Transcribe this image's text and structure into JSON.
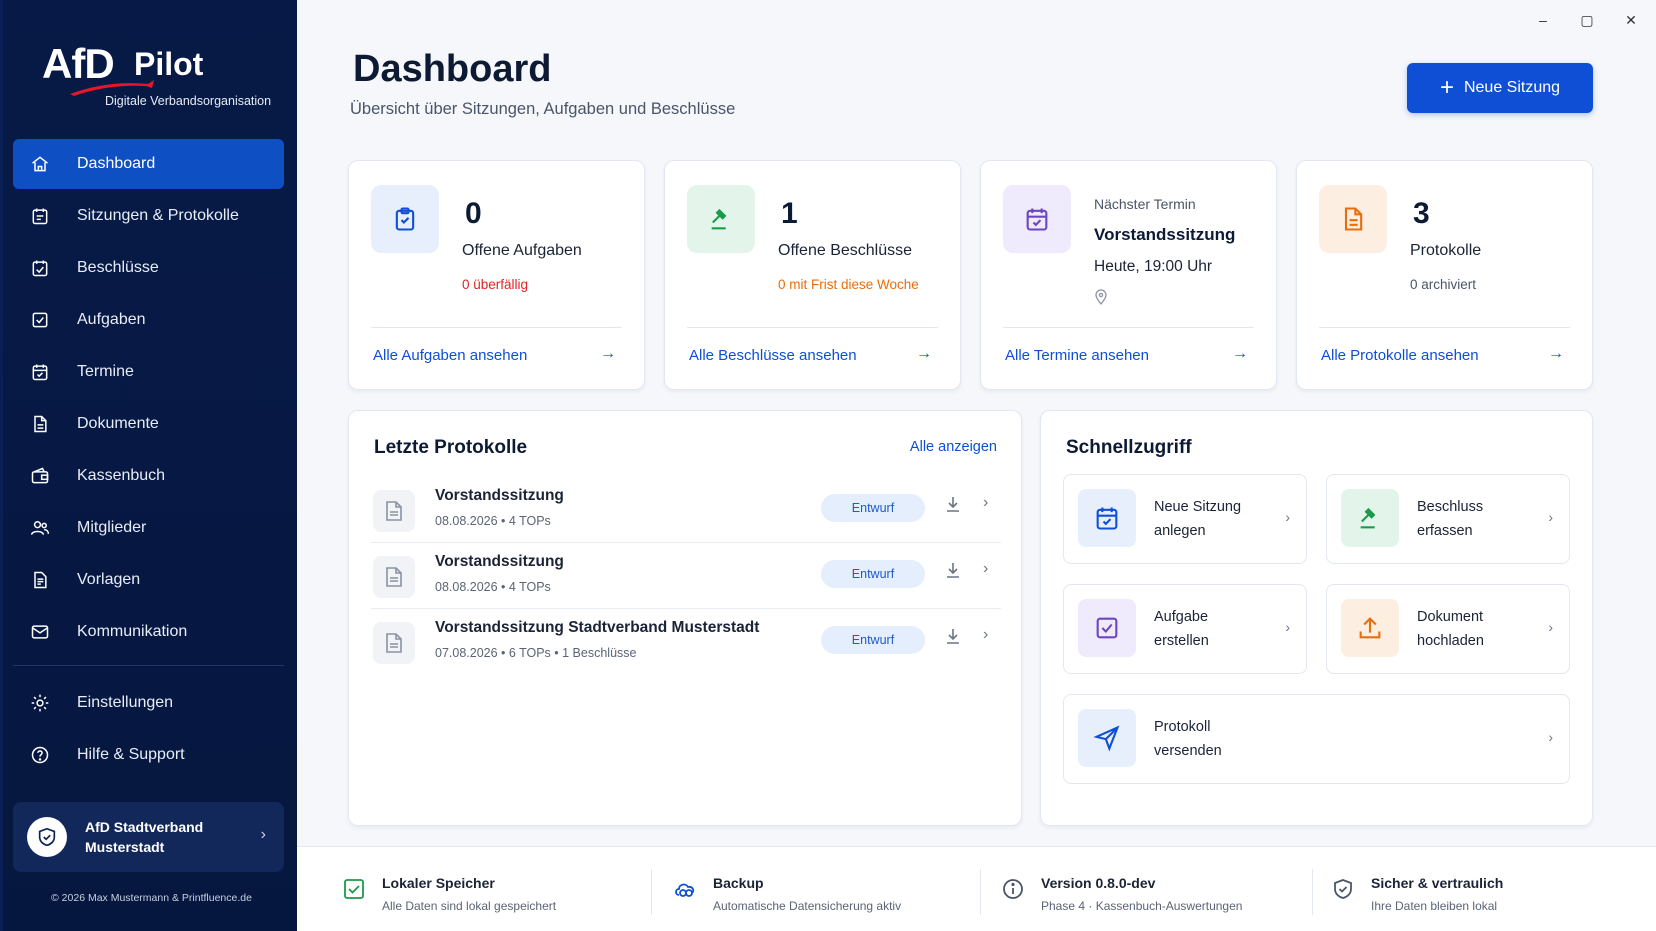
{
  "window": {
    "minimize": "–",
    "maximize": "▢",
    "close": "✕"
  },
  "brand": {
    "logo_text": "AfD",
    "logo_product": "Pilot",
    "tagline": "Digitale Verbandsorganisation"
  },
  "sidebar": {
    "items": [
      {
        "label": "Dashboard",
        "icon": "home-icon",
        "active": true
      },
      {
        "label": "Sitzungen & Protokolle",
        "icon": "calendar-list-icon"
      },
      {
        "label": "Beschlüsse",
        "icon": "calendar-check-icon"
      },
      {
        "label": "Aufgaben",
        "icon": "checkbox-icon"
      },
      {
        "label": "Termine",
        "icon": "calendar-icon"
      },
      {
        "label": "Dokumente",
        "icon": "document-icon"
      },
      {
        "label": "Kassenbuch",
        "icon": "wallet-icon"
      },
      {
        "label": "Mitglieder",
        "icon": "users-icon"
      },
      {
        "label": "Vorlagen",
        "icon": "template-icon"
      },
      {
        "label": "Kommunikation",
        "icon": "mail-icon"
      }
    ],
    "bottom_items": [
      {
        "label": "Einstellungen",
        "icon": "gear-icon"
      },
      {
        "label": "Hilfe & Support",
        "icon": "help-icon"
      }
    ],
    "org": {
      "line1": "AfD Stadtverband",
      "line2": "Musterstadt",
      "chevron": "›"
    },
    "copyright": "© 2026 Max Mustermann & Printfluence.de"
  },
  "header": {
    "title": "Dashboard",
    "subtitle": "Übersicht über Sitzungen, Aufgaben und Beschlüsse",
    "new_session_plus": "+",
    "new_session_label": "Neue Sitzung"
  },
  "stats": {
    "tasks": {
      "count": "0",
      "label": "Offene Aufgaben",
      "sub": "0 überfällig",
      "link": "Alle Aufgaben ansehen"
    },
    "decisions": {
      "count": "1",
      "label": "Offene Beschlüsse",
      "sub": "0 mit Frist diese Woche",
      "link": "Alle Beschlüsse ansehen"
    },
    "next": {
      "pre": "Nächster Termin",
      "title": "Vorstandssitzung",
      "time": "Heute, 19:00 Uhr",
      "link": "Alle Termine ansehen"
    },
    "protocols": {
      "count": "3",
      "label": "Protokolle",
      "sub": "0 archiviert",
      "link": "Alle Protokolle ansehen"
    },
    "arrow": "→"
  },
  "colors": {
    "accent": "#0f4fd6",
    "danger": "#e02424",
    "warning": "#ea6d0c",
    "sidebar_bg": "#071a47"
  },
  "recent": {
    "title": "Letzte Protokolle",
    "show_all": "Alle anzeigen",
    "rows": [
      {
        "name": "Vorstandssitzung",
        "meta": "08.08.2026  •  4 TOPs",
        "status": "Entwurf"
      },
      {
        "name": "Vorstandssitzung",
        "meta": "08.08.2026  •  4 TOPs",
        "status": "Entwurf"
      },
      {
        "name": "Vorstandssitzung Stadtverband Musterstadt",
        "meta": "07.08.2026  •  6 TOPs  •  1 Beschlüsse",
        "status": "Entwurf"
      }
    ],
    "chevron": "›"
  },
  "quick": {
    "title": "Schnellzugriff",
    "items": [
      {
        "l1": "Neue Sitzung",
        "l2": "anlegen"
      },
      {
        "l1": "Beschluss",
        "l2": "erfassen"
      },
      {
        "l1": "Aufgabe",
        "l2": "erstellen"
      },
      {
        "l1": "Dokument",
        "l2": "hochladen"
      },
      {
        "l1": "Protokoll",
        "l2": "versenden"
      }
    ],
    "chevron": "›"
  },
  "footer": {
    "items": [
      {
        "title": "Lokaler Speicher",
        "sub": "Alle Daten sind lokal gespeichert"
      },
      {
        "title": "Backup",
        "sub": "Automatische Datensicherung aktiv"
      },
      {
        "title": "Version 0.8.0-dev",
        "sub": "Phase 4 · Kassenbuch-Auswertungen"
      },
      {
        "title": "Sicher & vertraulich",
        "sub": "Ihre Daten bleiben lokal"
      }
    ]
  }
}
